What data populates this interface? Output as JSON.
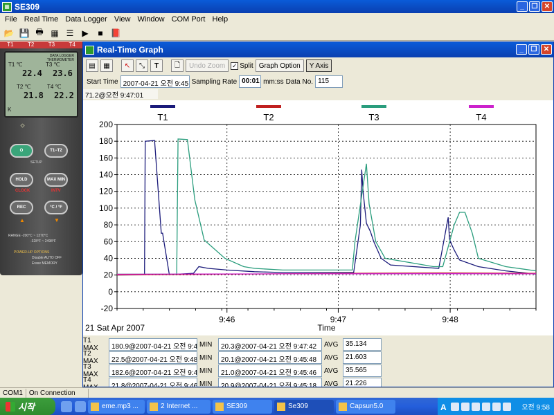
{
  "window": {
    "title": "SE309"
  },
  "menu": [
    "File",
    "Real Time",
    "Data Logger",
    "View",
    "Window",
    "COM Port",
    "Help"
  ],
  "meter": {
    "channels": [
      "T1",
      "T2",
      "T3",
      "T4"
    ],
    "header_line1": "DATA LOGGER",
    "header_line2": "THERMOMETER",
    "t1_label": "T1 ℃",
    "t1_value": "22.4",
    "t3_label": "T3 ℃",
    "t3_value": "23.6",
    "t2_label": "T2 ℃",
    "t2_value": "21.8",
    "t4_label": "T4 ℃",
    "t4_value": "22.2",
    "unit_k": "K",
    "btn_power": "O",
    "btn_t1t2": "T1−T2",
    "setup": "SETUP",
    "btn_hold": "HOLD",
    "btn_maxmin": "MAX MIN",
    "clock": "CLOCK",
    "intv": "INTV",
    "btn_rec": "REC",
    "btn_cf": "°C / °F",
    "range_line1": "RANGE   -200°C  ~  1370°C",
    "range_line2": "-328°F  ~  2498°F",
    "options_title": "POWER-UP OPTIONS",
    "option1": "Disable AUTO OFF",
    "option2": "Erase MEMORY"
  },
  "graph_window": {
    "title": "Real-Time Graph",
    "undo_zoom": "Undo Zoom",
    "split_label": "Split",
    "split_checked": "✓",
    "graph_option": "Graph Option",
    "y_axis": "Y Axis",
    "start_time_label": "Start Time",
    "start_time_value": "2007-04-21 오전 9:45:07",
    "sampling_rate_label": "Sampling Rate",
    "sampling_rate_value": "00:01",
    "sampling_unit": "mm:ss",
    "data_no_label": "Data No.",
    "data_no_value": "115",
    "cursor_readout": "71.2@오전 9:47:01",
    "date_label": "21 Sat Apr 2007"
  },
  "stats": [
    {
      "ch": "T1 MAX",
      "max": "180.9@2007-04-21 오전 9:45:5",
      "min": "20.3@2007-04-21 오전 9:47:42",
      "avg": "35.134"
    },
    {
      "ch": "T2 MAX",
      "max": "22.5@2007-04-21 오전 9:48:1E",
      "min": "20.1@2007-04-21 오전 9:45:48",
      "avg": "21.603"
    },
    {
      "ch": "T3 MAX",
      "max": "182.6@2007-04-21 오전 9:46:0",
      "min": "21.0@2007-04-21 오전 9:45:46",
      "avg": "35.565"
    },
    {
      "ch": "T4 MAX",
      "max": "21.8@2007-04-21 오전 9:46:1C",
      "min": "20.9@2007-04-21 오전 9:45:18",
      "avg": "21.226"
    }
  ],
  "stat_labels": {
    "min": "MIN",
    "avg": "AVG"
  },
  "status": {
    "port": "COM1",
    "connection": "On Connection"
  },
  "taskbar": {
    "start": "시작",
    "tasks": [
      "eme.mp3 ...",
      "2 Internet ...",
      "SE309",
      "Se309",
      "Capsun5.0"
    ],
    "clock": "오전 9:58"
  },
  "chart_data": {
    "type": "line",
    "xlabel": "Time",
    "x_unit": "time of day (hours)",
    "xlim": [
      9.7503,
      9.8128
    ],
    "x_ticks": [
      9.7667,
      9.7833,
      9.8
    ],
    "x_tick_labels": [
      "9:46",
      "9:47",
      "9:48"
    ],
    "ylim": [
      -20,
      200
    ],
    "y_ticks": [
      -20,
      0,
      20,
      40,
      60,
      80,
      100,
      120,
      140,
      160,
      180,
      200
    ],
    "grid": true,
    "legend_position": "top",
    "series": [
      {
        "name": "T1",
        "color": "#1a1a7a",
        "x": [
          9.7503,
          9.7544,
          9.7545,
          9.7559,
          9.7569,
          9.7571,
          9.7581,
          9.7617,
          9.7625,
          9.7639,
          9.7667,
          9.7708,
          9.775,
          9.7856,
          9.7866,
          9.7868,
          9.787,
          9.7875,
          9.7881,
          9.7886,
          9.7897,
          9.7911,
          9.7983,
          9.7997,
          9.7999,
          9.8003,
          9.8006,
          9.8014,
          9.8042,
          9.8083,
          9.8128
        ],
        "y": [
          20,
          20.3,
          180,
          180.9,
          70,
          70,
          20.5,
          22,
          30,
          28,
          26,
          24,
          23,
          23,
          80,
          146,
          120,
          82,
          72,
          60,
          40,
          32,
          28,
          89,
          63,
          55,
          50,
          38,
          30,
          25,
          21
        ]
      },
      {
        "name": "T2",
        "color": "#c02020",
        "x": [
          9.7503,
          9.7625,
          9.775,
          9.7875,
          9.8,
          9.8128
        ],
        "y": [
          20.1,
          20.8,
          21.5,
          22.2,
          22.5,
          22
        ]
      },
      {
        "name": "T3",
        "color": "#2a9d7d",
        "x": [
          9.7503,
          9.7575,
          9.7592,
          9.7594,
          9.7608,
          9.7619,
          9.7633,
          9.7664,
          9.7692,
          9.7708,
          9.775,
          9.7854,
          9.7858,
          9.7875,
          9.7879,
          9.7889,
          9.7903,
          9.7961,
          9.7975,
          9.7989,
          9.8006,
          9.8014,
          9.8022,
          9.8033,
          9.8042,
          9.8083,
          9.8128
        ],
        "y": [
          21,
          21,
          21,
          182.6,
          182,
          110,
          62,
          40,
          30,
          28,
          26,
          26,
          60,
          153,
          105,
          60,
          40,
          32,
          30,
          30,
          80,
          95,
          95,
          70,
          40,
          30,
          25
        ]
      },
      {
        "name": "T4",
        "color": "#cc22cc",
        "x": [
          9.7503,
          9.7625,
          9.775,
          9.7875,
          9.8,
          9.8128
        ],
        "y": [
          20.9,
          21.2,
          21.4,
          21.5,
          21.6,
          21.4
        ]
      }
    ]
  }
}
